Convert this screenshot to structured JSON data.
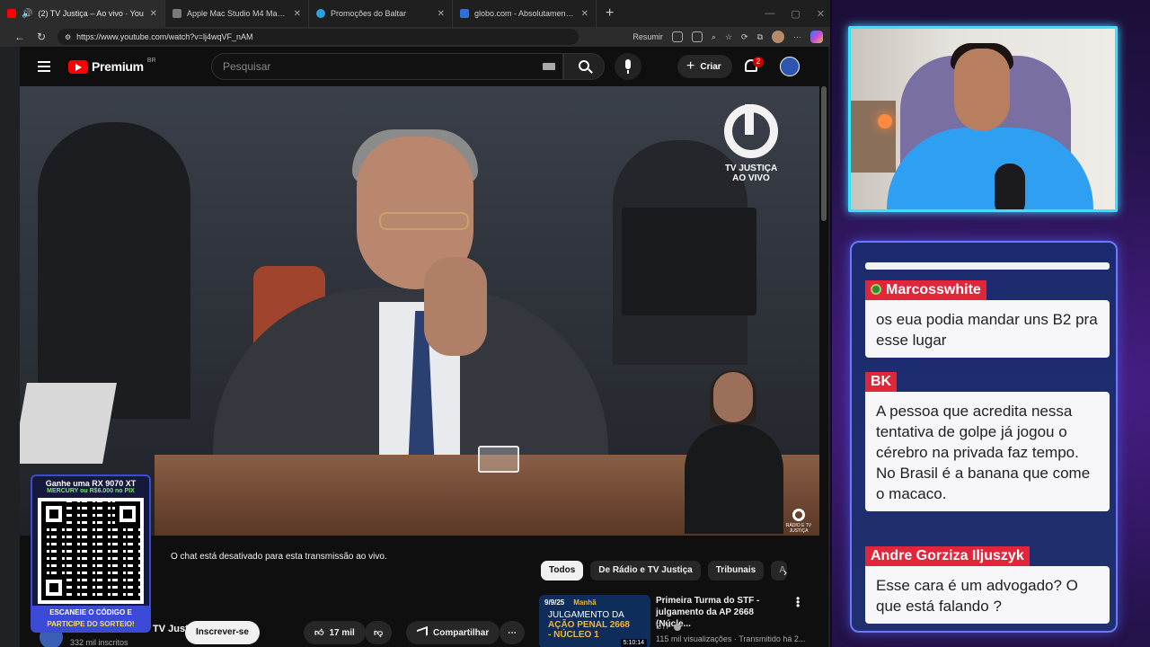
{
  "browser": {
    "tabs": [
      {
        "title": "(2) TV Justiça – Ao vivo · You",
        "color": "#ff0000",
        "active": true
      },
      {
        "title": "Apple Mac Studio M4 Max 16-co",
        "color": "#7a7a7a",
        "active": false
      },
      {
        "title": "Promoções do Baltar",
        "color": "#2aa3e0",
        "active": false
      },
      {
        "title": "globo.com - Absolutamente tudo",
        "color": "#2f6fe0",
        "active": false
      }
    ],
    "url": "https://www.youtube.com/watch?v=lj4wqVF_nAM",
    "summarize_label": "Resumir"
  },
  "youtube": {
    "logo_text": "Premium",
    "country": "BR",
    "search_placeholder": "Pesquisar",
    "create_label": "Criar",
    "notification_count": "2",
    "chat_disabled_text": "O chat está desativado para esta transmissão ao vivo.",
    "chips": [
      "Todos",
      "De Rádio e TV Justiça",
      "Tribunais",
      "A"
    ],
    "channel_name": "TV Justiça",
    "subscribers": "332 mil inscritos",
    "subscribe_label": "Inscrever-se",
    "likes": "17 mil",
    "share_label": "Compartilhar",
    "recommendation": {
      "thumb_date": "9/9/25",
      "thumb_period": "Manhã",
      "thumb_line1": "JULGAMENTO DA",
      "thumb_line2": "AÇÃO PENAL 2668",
      "thumb_line3": "- NÚCLEO 1",
      "duration": "5:10:14",
      "title": "Primeira Turma do STF - julgamento da AP 2668 (Núcle...",
      "channel": "STF",
      "meta": "115 mil visualizações · Transmitido há 2..."
    }
  },
  "video": {
    "logo_line1": "TV JUSTIÇA",
    "logo_line2": "AO VIVO",
    "small_logo": "RÁDIO E TV JUSTIÇA"
  },
  "promo": {
    "line1": "Ganhe uma RX 9070 XT",
    "line2": "MERCURY ou R$6.000 no PIX",
    "cta1": "ESCANEIE O CÓDIGO E",
    "cta2": "PARTICIPE DO SORTEIO!"
  },
  "chat": {
    "messages": [
      {
        "user": "Marcosswhite",
        "text": "os eua podia mandar uns B2 pra esse lugar"
      },
      {
        "user": "BK",
        "text": "A pessoa que acredita nessa tentativa de golpe já jogou o cérebro na privada faz tempo. No Brasil é a banana que come o macaco."
      },
      {
        "user": "Andre Gorziza Iljuszyk",
        "text": "Esse cara é um advogado? O que está falando ?"
      }
    ]
  },
  "colors": {
    "yt_red": "#ff0000",
    "chat_name_bg": "#e1263b",
    "webcam_border": "#39e3ff",
    "chat_border": "#6b78ff"
  }
}
